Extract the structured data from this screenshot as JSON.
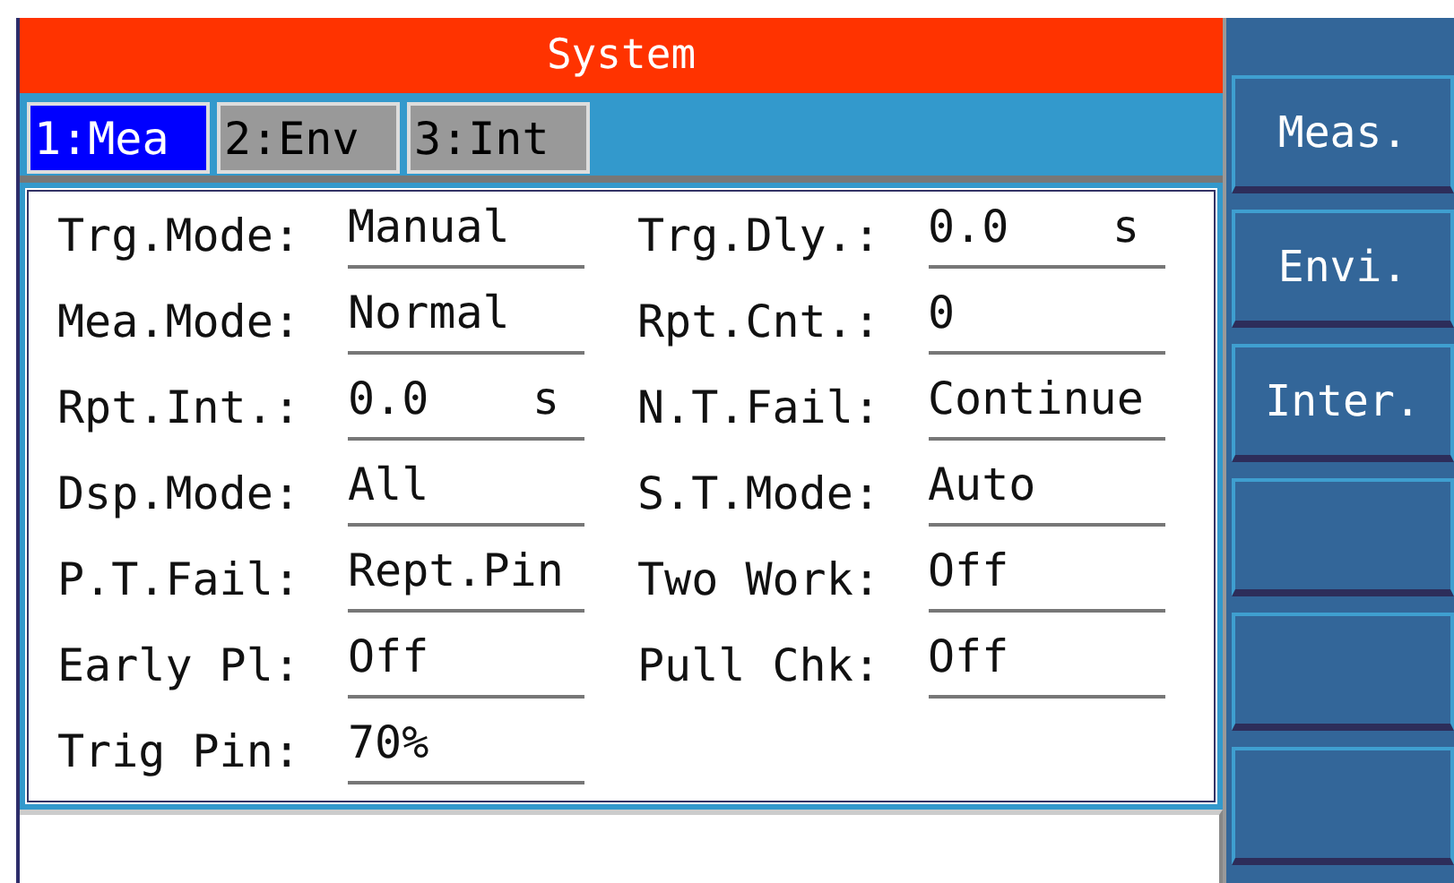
{
  "title": "System",
  "tabs": [
    {
      "label": "1:Mea",
      "selected": true
    },
    {
      "label": "2:Env",
      "selected": false
    },
    {
      "label": "3:Int",
      "selected": false
    }
  ],
  "settings": [
    {
      "label": "Trg.Mode:",
      "value": "Manual"
    },
    {
      "label": "Trg.Dly.:",
      "value": "0.0",
      "unit": "s"
    },
    {
      "label": "Mea.Mode:",
      "value": "Normal"
    },
    {
      "label": "Rpt.Cnt.:",
      "value": "0"
    },
    {
      "label": "Rpt.Int.:",
      "value": "0.0",
      "unit": "s"
    },
    {
      "label": "N.T.Fail:",
      "value": "Continue"
    },
    {
      "label": "Dsp.Mode:",
      "value": "All"
    },
    {
      "label": "S.T.Mode:",
      "value": "Auto"
    },
    {
      "label": "P.T.Fail:",
      "value": "Rept.Pin"
    },
    {
      "label": "Two Work:",
      "value": "Off"
    },
    {
      "label": "Early Pl:",
      "value": "Off"
    },
    {
      "label": "Pull Chk:",
      "value": "Off"
    },
    {
      "label": "Trig Pin:",
      "value": "70%"
    }
  ],
  "softkeys": [
    {
      "kind": "key",
      "label": "Meas."
    },
    {
      "kind": "key",
      "label": "Envi."
    },
    {
      "kind": "key",
      "label": "Inter."
    },
    {
      "kind": "blank"
    },
    {
      "kind": "blank"
    },
    {
      "kind": "blank"
    }
  ]
}
